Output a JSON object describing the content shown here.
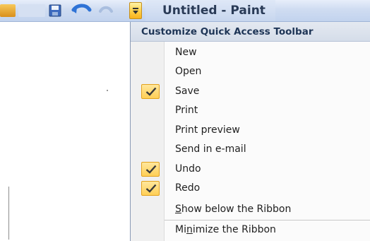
{
  "window": {
    "title": "Untitled - Paint"
  },
  "quick_access_toolbar": {
    "buttons": [
      {
        "name": "save",
        "icon": "save-icon"
      },
      {
        "name": "undo",
        "icon": "undo-icon"
      },
      {
        "name": "redo",
        "icon": "redo-icon"
      },
      {
        "name": "customize",
        "icon": "dropdown-arrow-icon"
      }
    ]
  },
  "menu": {
    "header": "Customize Quick Access Toolbar",
    "items": [
      {
        "label": "New",
        "checked": false
      },
      {
        "label": "Open",
        "checked": false
      },
      {
        "label": "Save",
        "checked": true
      },
      {
        "label": "Print",
        "checked": false
      },
      {
        "label": "Print preview",
        "checked": false
      },
      {
        "label": "Send in e-mail",
        "checked": false
      },
      {
        "label": "Undo",
        "checked": true
      },
      {
        "label": "Redo",
        "checked": true
      }
    ],
    "options": [
      {
        "label": "Show below the Ribbon",
        "access_key": "S"
      },
      {
        "label": "Minimize the Ribbon",
        "access_key": "n"
      }
    ]
  },
  "colors": {
    "highlight_accent": "#ffcf56",
    "title_text": "#2a3b57",
    "menu_header_text": "#1e3556"
  }
}
